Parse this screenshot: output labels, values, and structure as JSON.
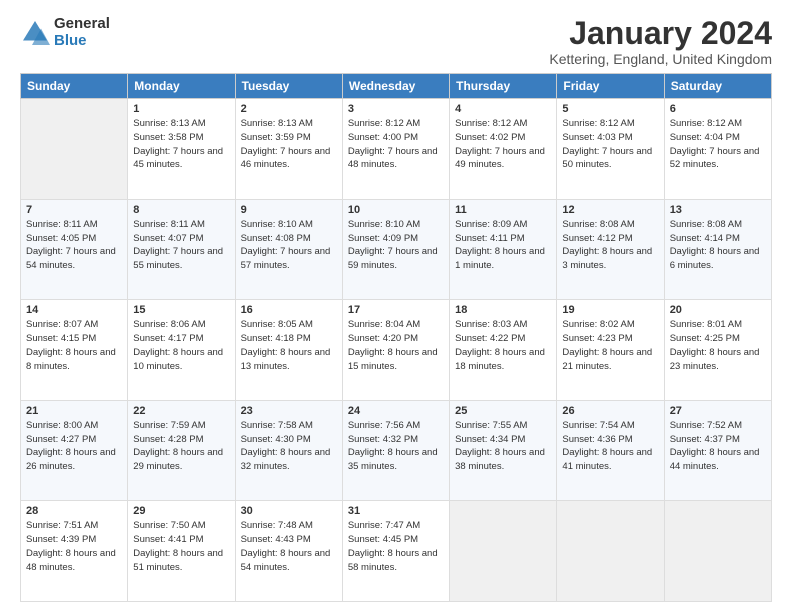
{
  "logo": {
    "general": "General",
    "blue": "Blue"
  },
  "header": {
    "title": "January 2024",
    "subtitle": "Kettering, England, United Kingdom"
  },
  "weekdays": [
    "Sunday",
    "Monday",
    "Tuesday",
    "Wednesday",
    "Thursday",
    "Friday",
    "Saturday"
  ],
  "weeks": [
    [
      {
        "day": "",
        "empty": true
      },
      {
        "day": "1",
        "sunrise": "8:13 AM",
        "sunset": "3:58 PM",
        "daylight": "7 hours and 45 minutes."
      },
      {
        "day": "2",
        "sunrise": "8:13 AM",
        "sunset": "3:59 PM",
        "daylight": "7 hours and 46 minutes."
      },
      {
        "day": "3",
        "sunrise": "8:12 AM",
        "sunset": "4:00 PM",
        "daylight": "7 hours and 48 minutes."
      },
      {
        "day": "4",
        "sunrise": "8:12 AM",
        "sunset": "4:02 PM",
        "daylight": "7 hours and 49 minutes."
      },
      {
        "day": "5",
        "sunrise": "8:12 AM",
        "sunset": "4:03 PM",
        "daylight": "7 hours and 50 minutes."
      },
      {
        "day": "6",
        "sunrise": "8:12 AM",
        "sunset": "4:04 PM",
        "daylight": "7 hours and 52 minutes."
      }
    ],
    [
      {
        "day": "7",
        "sunrise": "8:11 AM",
        "sunset": "4:05 PM",
        "daylight": "7 hours and 54 minutes."
      },
      {
        "day": "8",
        "sunrise": "8:11 AM",
        "sunset": "4:07 PM",
        "daylight": "7 hours and 55 minutes."
      },
      {
        "day": "9",
        "sunrise": "8:10 AM",
        "sunset": "4:08 PM",
        "daylight": "7 hours and 57 minutes."
      },
      {
        "day": "10",
        "sunrise": "8:10 AM",
        "sunset": "4:09 PM",
        "daylight": "7 hours and 59 minutes."
      },
      {
        "day": "11",
        "sunrise": "8:09 AM",
        "sunset": "4:11 PM",
        "daylight": "8 hours and 1 minute."
      },
      {
        "day": "12",
        "sunrise": "8:08 AM",
        "sunset": "4:12 PM",
        "daylight": "8 hours and 3 minutes."
      },
      {
        "day": "13",
        "sunrise": "8:08 AM",
        "sunset": "4:14 PM",
        "daylight": "8 hours and 6 minutes."
      }
    ],
    [
      {
        "day": "14",
        "sunrise": "8:07 AM",
        "sunset": "4:15 PM",
        "daylight": "8 hours and 8 minutes."
      },
      {
        "day": "15",
        "sunrise": "8:06 AM",
        "sunset": "4:17 PM",
        "daylight": "8 hours and 10 minutes."
      },
      {
        "day": "16",
        "sunrise": "8:05 AM",
        "sunset": "4:18 PM",
        "daylight": "8 hours and 13 minutes."
      },
      {
        "day": "17",
        "sunrise": "8:04 AM",
        "sunset": "4:20 PM",
        "daylight": "8 hours and 15 minutes."
      },
      {
        "day": "18",
        "sunrise": "8:03 AM",
        "sunset": "4:22 PM",
        "daylight": "8 hours and 18 minutes."
      },
      {
        "day": "19",
        "sunrise": "8:02 AM",
        "sunset": "4:23 PM",
        "daylight": "8 hours and 21 minutes."
      },
      {
        "day": "20",
        "sunrise": "8:01 AM",
        "sunset": "4:25 PM",
        "daylight": "8 hours and 23 minutes."
      }
    ],
    [
      {
        "day": "21",
        "sunrise": "8:00 AM",
        "sunset": "4:27 PM",
        "daylight": "8 hours and 26 minutes."
      },
      {
        "day": "22",
        "sunrise": "7:59 AM",
        "sunset": "4:28 PM",
        "daylight": "8 hours and 29 minutes."
      },
      {
        "day": "23",
        "sunrise": "7:58 AM",
        "sunset": "4:30 PM",
        "daylight": "8 hours and 32 minutes."
      },
      {
        "day": "24",
        "sunrise": "7:56 AM",
        "sunset": "4:32 PM",
        "daylight": "8 hours and 35 minutes."
      },
      {
        "day": "25",
        "sunrise": "7:55 AM",
        "sunset": "4:34 PM",
        "daylight": "8 hours and 38 minutes."
      },
      {
        "day": "26",
        "sunrise": "7:54 AM",
        "sunset": "4:36 PM",
        "daylight": "8 hours and 41 minutes."
      },
      {
        "day": "27",
        "sunrise": "7:52 AM",
        "sunset": "4:37 PM",
        "daylight": "8 hours and 44 minutes."
      }
    ],
    [
      {
        "day": "28",
        "sunrise": "7:51 AM",
        "sunset": "4:39 PM",
        "daylight": "8 hours and 48 minutes."
      },
      {
        "day": "29",
        "sunrise": "7:50 AM",
        "sunset": "4:41 PM",
        "daylight": "8 hours and 51 minutes."
      },
      {
        "day": "30",
        "sunrise": "7:48 AM",
        "sunset": "4:43 PM",
        "daylight": "8 hours and 54 minutes."
      },
      {
        "day": "31",
        "sunrise": "7:47 AM",
        "sunset": "4:45 PM",
        "daylight": "8 hours and 58 minutes."
      },
      {
        "day": "",
        "empty": true
      },
      {
        "day": "",
        "empty": true
      },
      {
        "day": "",
        "empty": true
      }
    ]
  ],
  "labels": {
    "sunrise": "Sunrise:",
    "sunset": "Sunset:",
    "daylight": "Daylight:"
  }
}
